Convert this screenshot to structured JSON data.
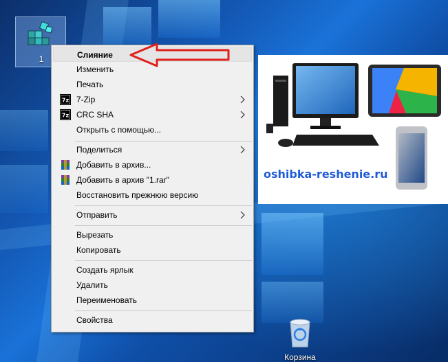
{
  "desktop": {
    "file_icon": {
      "label": "1",
      "icon": "registry-file-icon"
    },
    "recycle_bin": {
      "label": "Корзина",
      "icon": "recycle-bin-icon"
    }
  },
  "context_menu": {
    "items": [
      {
        "label": "Слияние",
        "icon": null,
        "submenu": false,
        "bold": true,
        "highlighted": true
      },
      {
        "label": "Изменить",
        "icon": null,
        "submenu": false
      },
      {
        "label": "Печать",
        "icon": null,
        "submenu": false
      },
      {
        "label": "7-Zip",
        "icon": "7zip-icon",
        "submenu": true
      },
      {
        "label": "CRC SHA",
        "icon": "7zip-icon",
        "submenu": true
      },
      {
        "label": "Открыть с помощью...",
        "icon": null,
        "submenu": false
      },
      {
        "label": "Поделиться",
        "icon": null,
        "submenu": true
      },
      {
        "label": "Добавить в архив...",
        "icon": "winrar-icon",
        "submenu": false
      },
      {
        "label": "Добавить в архив \"1.rar\"",
        "icon": "winrar-icon",
        "submenu": false
      },
      {
        "label": "Восстановить прежнюю версию",
        "icon": null,
        "submenu": false
      },
      {
        "label": "Отправить",
        "icon": null,
        "submenu": true
      },
      {
        "label": "Вырезать",
        "icon": null,
        "submenu": false
      },
      {
        "label": "Копировать",
        "icon": null,
        "submenu": false
      },
      {
        "label": "Создать ярлык",
        "icon": null,
        "submenu": false
      },
      {
        "label": "Удалить",
        "icon": null,
        "submenu": false
      },
      {
        "label": "Переименовать",
        "icon": null,
        "submenu": false
      },
      {
        "label": "Свойства",
        "icon": null,
        "submenu": false
      }
    ],
    "sevenzip_icon_text": "7z"
  },
  "annotation": {
    "arrow_color": "#e0201c"
  },
  "ad": {
    "site": "oshibka-reshenie.ru"
  },
  "colors": {
    "menu_bg": "#f0f0f0",
    "highlight": "#e5e5e5",
    "desktop_blue": "#1357b3",
    "site_blue": "#1f5cd6"
  }
}
